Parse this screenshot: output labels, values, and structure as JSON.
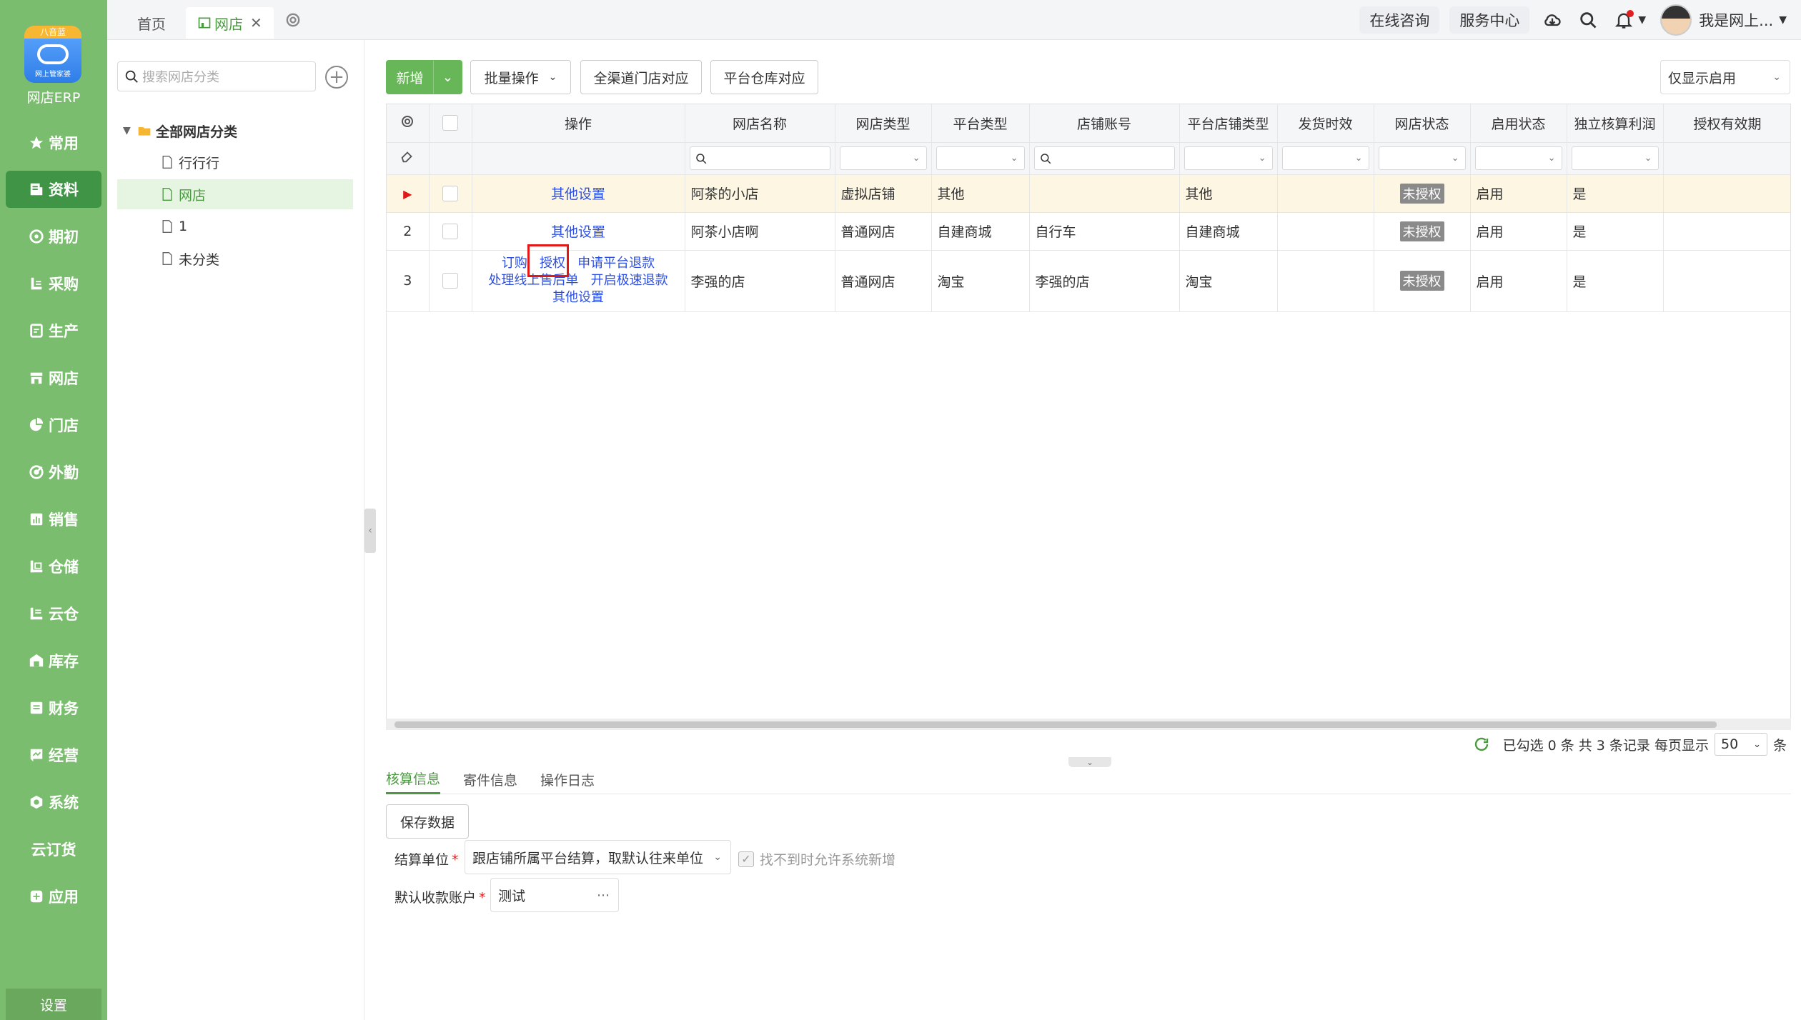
{
  "app": {
    "logo_top": "八音蓝",
    "logo_sub": "网上管家婆",
    "name": "网店ERP"
  },
  "sidebar": {
    "items": [
      {
        "label": "常用",
        "icon": "star-icon"
      },
      {
        "label": "资料",
        "icon": "document-icon",
        "active": true
      },
      {
        "label": "期初",
        "icon": "target-icon"
      },
      {
        "label": "采购",
        "icon": "purchase-icon"
      },
      {
        "label": "生产",
        "icon": "production-icon"
      },
      {
        "label": "网店",
        "icon": "shop-icon"
      },
      {
        "label": "门店",
        "icon": "pie-icon"
      },
      {
        "label": "外勤",
        "icon": "field-icon"
      },
      {
        "label": "销售",
        "icon": "sales-chart-icon"
      },
      {
        "label": "仓储",
        "icon": "warehouse-icon"
      },
      {
        "label": "云仓",
        "icon": "cloud-warehouse-icon"
      },
      {
        "label": "库存",
        "icon": "inventory-icon"
      },
      {
        "label": "财务",
        "icon": "finance-icon"
      },
      {
        "label": "经营",
        "icon": "business-icon"
      },
      {
        "label": "系统",
        "icon": "system-icon"
      },
      {
        "label": "云订货",
        "icon": ""
      },
      {
        "label": "应用",
        "icon": "apps-icon"
      }
    ],
    "settings_label": "设置"
  },
  "tabs": [
    {
      "label": "首页"
    },
    {
      "label": "网店",
      "active": true
    }
  ],
  "header": {
    "online_consult": "在线咨询",
    "service_center": "服务中心",
    "user_name": "我是网上..."
  },
  "category": {
    "search_placeholder": "搜索网店分类",
    "root": "全部网店分类",
    "children": [
      "行行行",
      "网店",
      "1",
      "未分类"
    ],
    "selected": "网店"
  },
  "toolbar": {
    "add": "新增",
    "batch": "批量操作",
    "omni_store_map": "全渠道门店对应",
    "platform_warehouse_map": "平台仓库对应",
    "filter_value": "仅显示启用"
  },
  "table": {
    "columns": [
      "操作",
      "网店名称",
      "网店类型",
      "平台类型",
      "店铺账号",
      "平台店铺类型",
      "发货时效",
      "网店状态",
      "启用状态",
      "独立核算利润",
      "授权有效期"
    ],
    "rows": [
      {
        "no": "",
        "ops": [
          "其他设置"
        ],
        "name": "阿茶的小店",
        "type": "虚拟店铺",
        "platform": "其他",
        "account": "",
        "platform_shop_type": "其他",
        "ship_time": "",
        "status": "未授权",
        "enabled": "启用",
        "independent": "是",
        "auth_expire": ""
      },
      {
        "no": "2",
        "ops": [
          "其他设置"
        ],
        "name": "阿茶小店啊",
        "type": "普通网店",
        "platform": "自建商城",
        "account": "自行车",
        "platform_shop_type": "自建商城",
        "ship_time": "",
        "status": "未授权",
        "enabled": "启用",
        "independent": "是",
        "auth_expire": ""
      },
      {
        "no": "3",
        "ops": [
          "订购",
          "授权",
          "申请平台退款",
          "处理线上售后单",
          "开启极速退款",
          "其他设置"
        ],
        "name": "李强的店",
        "type": "普通网店",
        "platform": "淘宝",
        "account": "李强的店",
        "platform_shop_type": "淘宝",
        "ship_time": "",
        "status": "未授权",
        "enabled": "启用",
        "independent": "是",
        "auth_expire": ""
      }
    ]
  },
  "pager": {
    "summary": "已勾选 0 条 共 3 条记录 每页显示",
    "page_size": "50",
    "unit": "条"
  },
  "bottom": {
    "tabs": [
      "核算信息",
      "寄件信息",
      "操作日志"
    ],
    "save": "保存数据",
    "settle_label": "结算单位",
    "settle_value": "跟店铺所属平台结算，取默认往来单位",
    "auto_create": "找不到时允许系统新增",
    "account_label": "默认收款账户",
    "account_value": "测试"
  },
  "colors": {
    "sidebar": "#7bbd6e",
    "accent": "#4a9b3f",
    "link": "#2c4ee0",
    "highlight": "#e01818"
  }
}
